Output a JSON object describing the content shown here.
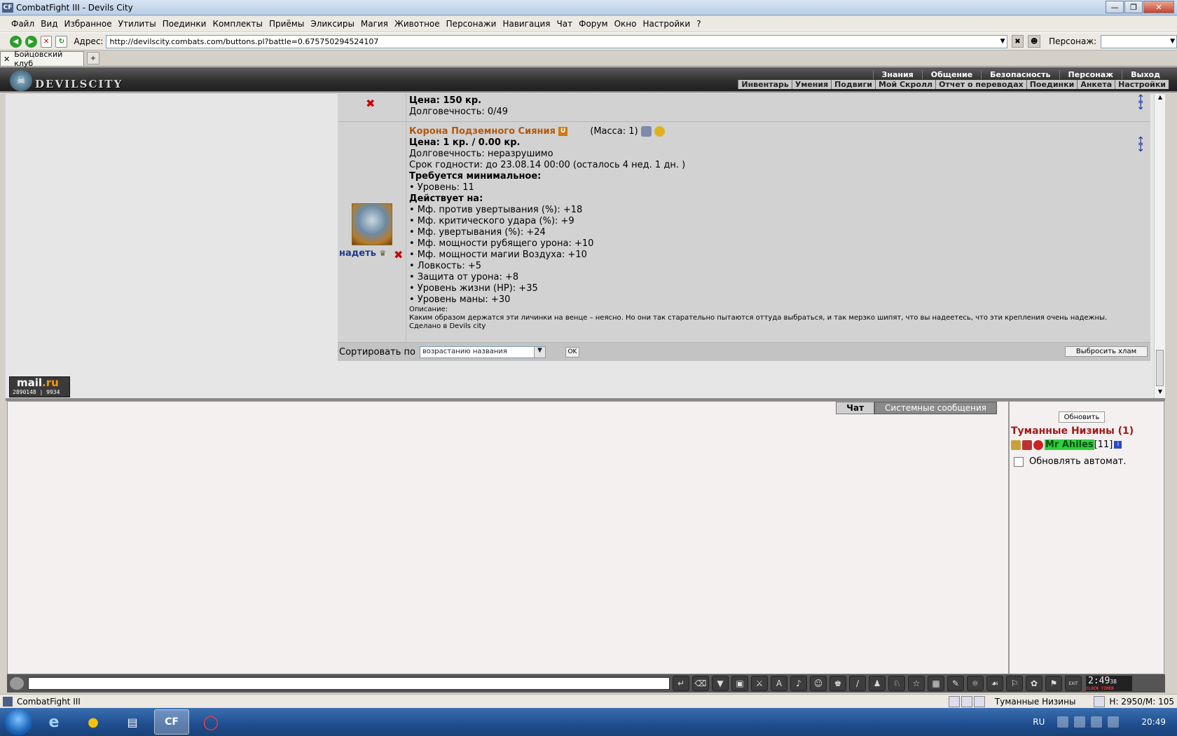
{
  "window": {
    "title": "CombatFight III - Devils City",
    "icon_text": "CF"
  },
  "menu": [
    "Файл",
    "Вид",
    "Избранное",
    "Утилиты",
    "Поединки",
    "Комплекты",
    "Приёмы",
    "Эликсиры",
    "Магия",
    "Животное",
    "Персонажи",
    "Навигация",
    "Чат",
    "Форум",
    "Окно",
    "Настройки",
    "?"
  ],
  "address": {
    "label": "Адрес:",
    "url": "http://devilscity.combats.com/buttons.pl?battle=0.675750294524107"
  },
  "persona": {
    "label": "Персонаж:",
    "value": ""
  },
  "tabs": {
    "active": "Бойцовский клуб",
    "new_tab": "+"
  },
  "game_header": {
    "brand": "DEVILSCITY",
    "topnav": [
      "Знания",
      "Общение",
      "Безопасность",
      "Персонаж",
      "Выход"
    ],
    "subnav": [
      "Инвентарь",
      "Умения",
      "Подвиги",
      "Мой Скролл",
      "Отчет о переводах",
      "Поединки",
      "Анкета",
      "Настройки"
    ]
  },
  "item_prev": {
    "price": "Цена: 150 кр.",
    "durability": "Долговечность: 0/49"
  },
  "item": {
    "name": "Корона Подземного Сияния",
    "badge": "U",
    "mass": "(Масса: 1)",
    "price": "Цена: 1 кр. / 0.00 кр.",
    "durability": "Долговечность: неразрушимо",
    "expiry": "Срок годности: до 23.08.14 00:00 (осталось 4 нед. 1 дн. )",
    "req_title": "Требуется минимальное:",
    "req_level": "• Уровень: 11",
    "effects_title": "Действует на:",
    "effects": [
      "• Мф. против увертывания (%): +18",
      "• Мф. критического удара (%): +9",
      "• Мф. увертывания (%): +24",
      "• Мф. мощности рубящего урона: +10",
      "• Мф. мощности магии Воздуха: +10",
      "• Ловкость: +5",
      "• Защита от урона: +8",
      "• Уровень жизни (HP): +35",
      "• Уровень маны: +30"
    ],
    "desc_title": "Описание:",
    "desc_text": "Каким образом держатся эти личинки на венце – неясно. Но они так старательно пытаются оттуда выбраться, и так мерзко шипят, что вы надеетесь, что эти крепления очень надежны.",
    "made_in": "Сделано в Devils city",
    "equip_label": "надеть"
  },
  "sort": {
    "label": "Сортировать по",
    "selected": "возрастанию названия",
    "ok": "OK",
    "junk": "Выбросить хлам"
  },
  "mailru": {
    "logo": "mail",
    "logo_suffix": ".ru",
    "counter1": "2890148",
    "counter2": "9934"
  },
  "chat": {
    "tab_chat": "Чат",
    "tab_system": "Системные сообщения"
  },
  "players": {
    "refresh": "Обновить",
    "location": "Туманные Низины (1)",
    "player_name": "Mr Ahiles",
    "player_level": "[11]",
    "info": "i",
    "auto_refresh": "Обновлять автомат."
  },
  "clock": {
    "time": "2:49",
    "seconds": "38",
    "labels": "CLOCK TIMER",
    "exit": "EXIT"
  },
  "statusbar": {
    "left": "CombatFight III",
    "location": "Туманные Низины",
    "hm": "H: 2950/M: 105"
  },
  "taskbar": {
    "app_label": "CF",
    "lang": "RU",
    "time": "20:49"
  }
}
